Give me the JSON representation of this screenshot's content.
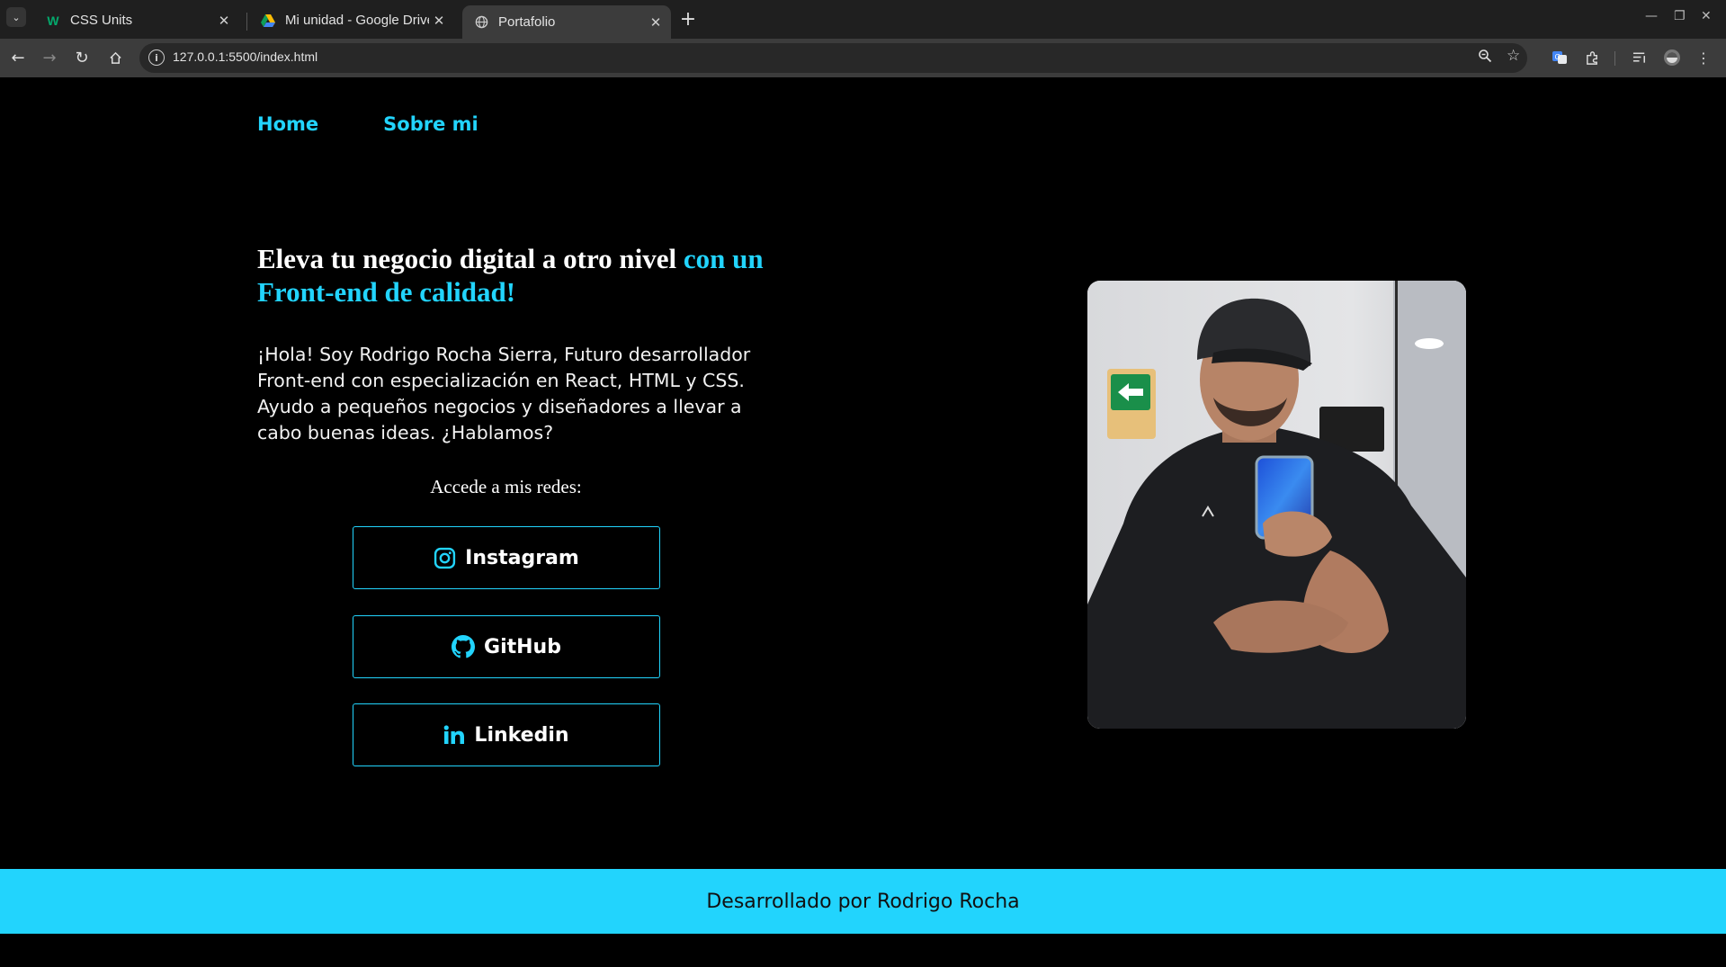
{
  "browser": {
    "tabs": [
      {
        "title": "CSS Units",
        "icon": "w3schools-icon",
        "active": false
      },
      {
        "title": "Mi unidad - Google Drive",
        "icon": "google-drive-icon",
        "active": false
      },
      {
        "title": "Portafolio",
        "icon": "globe-icon",
        "active": true
      }
    ],
    "url": "127.0.0.1:5500/index.html"
  },
  "nav": {
    "items": [
      {
        "label": "Home"
      },
      {
        "label": "Sobre mi"
      }
    ]
  },
  "hero": {
    "title_main": "Eleva tu negocio digital a otro nivel",
    "title_accent": "con un Front-end de calidad!",
    "text": "¡Hola! Soy Rodrigo Rocha Sierra, Futuro desarrollador Front-end con especialización en React, HTML y CSS. Ayudo a pequeños negocios y diseñadores a llevar a cabo buenas ideas. ¿Hablamos?",
    "redes_label": "Accede a mis redes:"
  },
  "social": [
    {
      "label": "Instagram",
      "icon": "instagram-icon"
    },
    {
      "label": "GitHub",
      "icon": "github-icon"
    },
    {
      "label": "Linkedin",
      "icon": "linkedin-icon"
    }
  ],
  "footer": {
    "text": "Desarrollado por Rodrigo Rocha"
  },
  "colors": {
    "accent": "#22d4fd",
    "background": "#000000",
    "chrome_dark": "#1f1f1f",
    "chrome_toolbar": "#3c3c3c"
  }
}
